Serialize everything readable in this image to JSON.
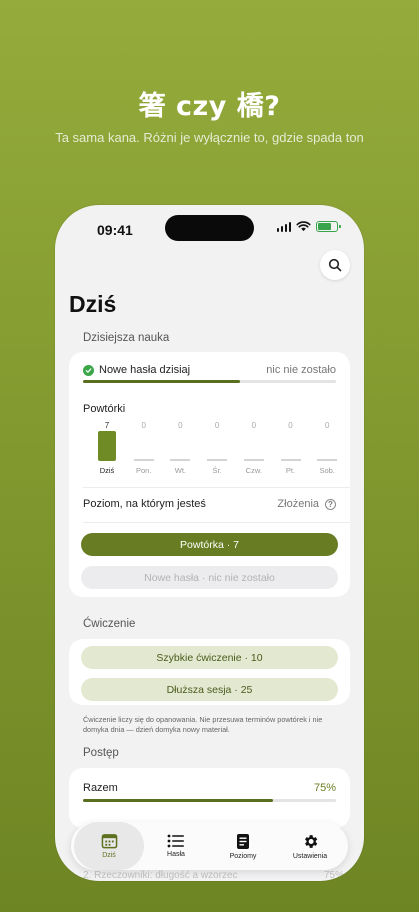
{
  "hero": {
    "title": "箸 czy 橋?",
    "subtitle": "Ta sama kana. Różni je wyłącznie to, gdzie spada ton"
  },
  "status_bar": {
    "time": "09:41",
    "icons": [
      "signal-icon",
      "wifi-icon",
      "battery-icon"
    ]
  },
  "search": {
    "icon": "search-icon"
  },
  "page_title": "Dziś",
  "today": {
    "section_label": "Dzisiejsza nauka",
    "new_words_label": "Nowe hasła dzisiaj",
    "new_words_status": "nic nie zostało",
    "new_words_progress": 0.62,
    "reviews_label": "Powtórki",
    "days": [
      {
        "label": "Dziś",
        "count": "7",
        "value": 7
      },
      {
        "label": "Pon.",
        "count": "0",
        "value": 0
      },
      {
        "label": "Wt.",
        "count": "0",
        "value": 0
      },
      {
        "label": "Śr.",
        "count": "0",
        "value": 0
      },
      {
        "label": "Czw.",
        "count": "0",
        "value": 0
      },
      {
        "label": "Pt.",
        "count": "0",
        "value": 0
      },
      {
        "label": "Sob.",
        "count": "0",
        "value": 0
      }
    ],
    "level_label": "Poziom, na którym jesteś",
    "level_value": "Złożenia",
    "info_icon": "info-icon",
    "review_button": "Powtórka · 7",
    "new_button": "Nowe hasła · nic nie zostało"
  },
  "practice": {
    "section_label": "Ćwiczenie",
    "quick_button": "Szybkie ćwiczenie · 10",
    "long_button": "Dłuższa sesja · 25",
    "note": "Ćwiczenie liczy się do opanowania. Nie przesuwa terminów powtórek i nie domyka dnia — dzień domyka nowy materiał."
  },
  "progress": {
    "section_label": "Postęp",
    "total_label": "Razem",
    "total_value": "75%",
    "total_fraction": 0.75,
    "faded_item": "2. Rzeczowniki: długość a wzorzec",
    "faded_value": "75%"
  },
  "tabs": [
    {
      "label": "Dziś",
      "icon": "calendar-icon",
      "active": true
    },
    {
      "label": "Hasła",
      "icon": "list-icon",
      "active": false
    },
    {
      "label": "Poziomy",
      "icon": "document-icon",
      "active": false
    },
    {
      "label": "Ustawienia",
      "icon": "gear-icon",
      "active": false
    }
  ],
  "colors": {
    "accent": "#687d23",
    "success": "#3aa648",
    "background_top": "#95ab3b"
  }
}
